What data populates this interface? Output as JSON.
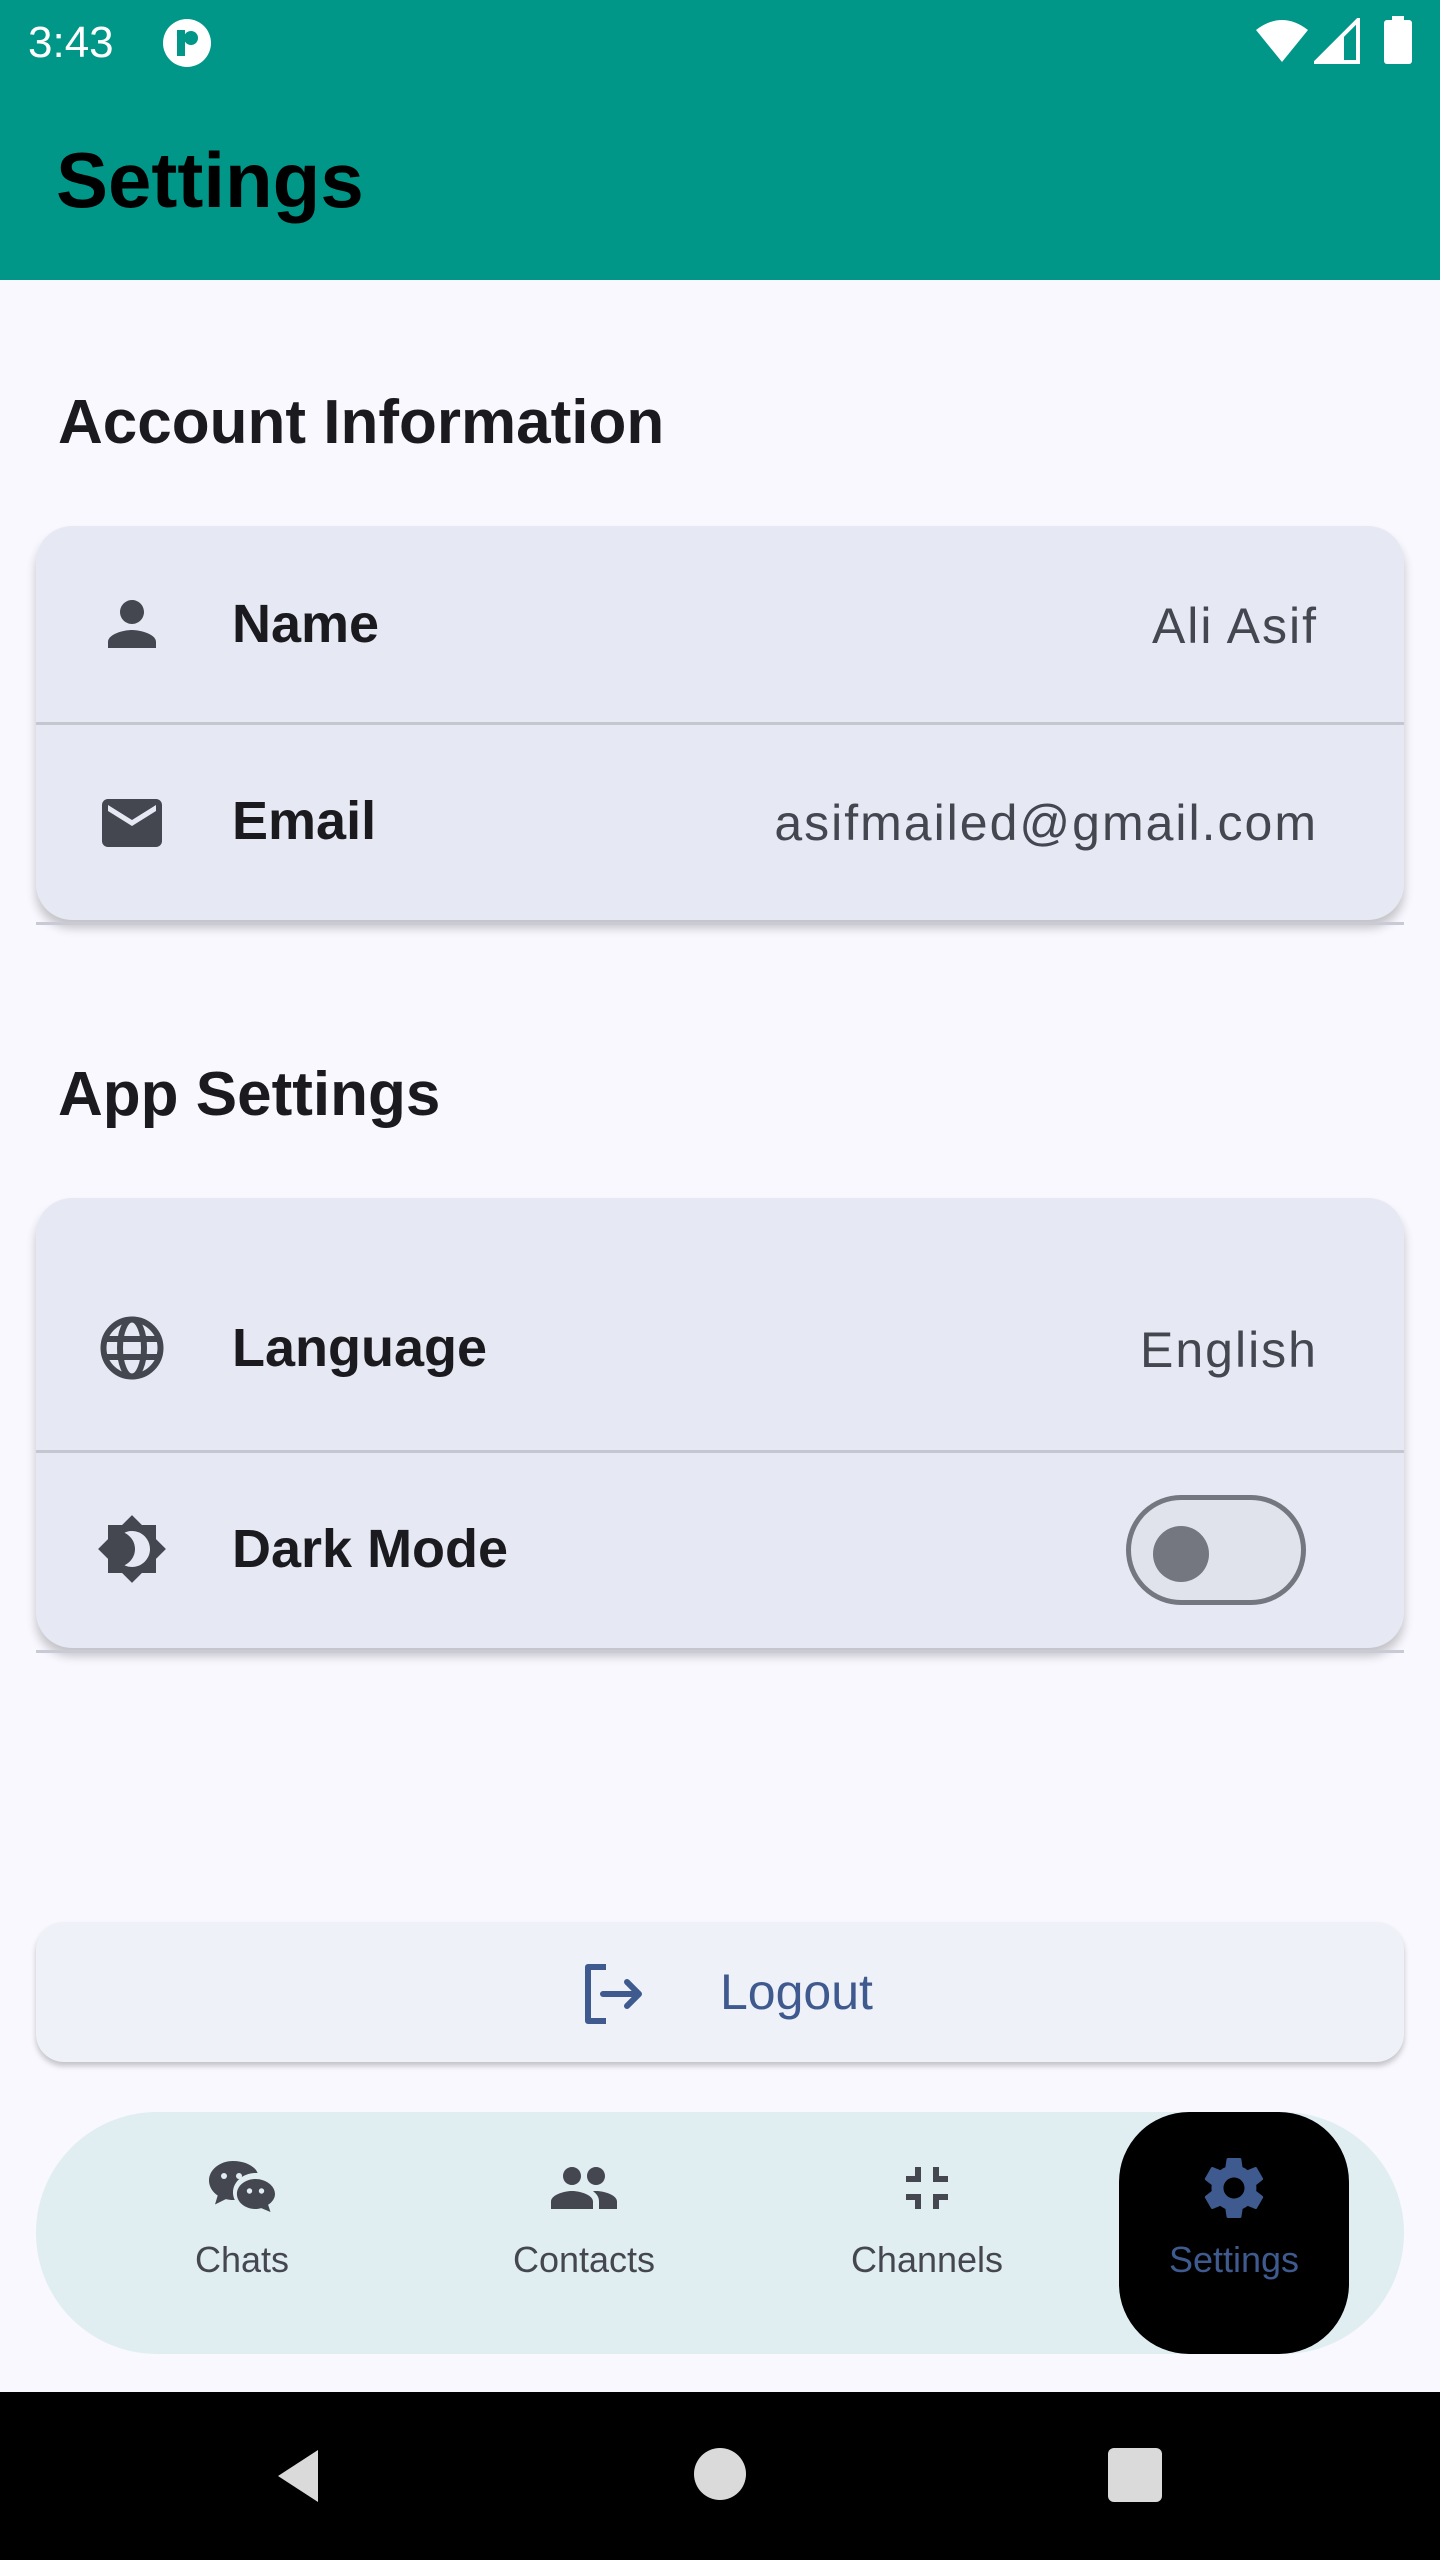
{
  "status_bar": {
    "time": "3:43"
  },
  "app_bar": {
    "title": "Settings"
  },
  "account_section": {
    "title": "Account Information",
    "rows": [
      {
        "label": "Name",
        "value": "Ali Asif",
        "icon": "person-icon"
      },
      {
        "label": "Email",
        "value": "asifmailed@gmail.com",
        "icon": "mail-icon"
      }
    ]
  },
  "app_settings_section": {
    "title": "App Settings",
    "rows": [
      {
        "label": "Language",
        "value": "English",
        "icon": "globe-icon"
      },
      {
        "label": "Dark Mode",
        "toggle_on": false,
        "icon": "brightness-icon"
      }
    ]
  },
  "logout": {
    "label": "Logout",
    "icon": "logout-icon"
  },
  "bottom_nav": {
    "items": [
      {
        "label": "Chats",
        "icon": "chat-bubbles-icon",
        "active": false
      },
      {
        "label": "Contacts",
        "icon": "people-icon",
        "active": false
      },
      {
        "label": "Channels",
        "icon": "compress-icon",
        "active": false
      },
      {
        "label": "Settings",
        "icon": "gear-icon",
        "active": true
      }
    ]
  },
  "colors": {
    "app_bar": "#009688",
    "card": "#E6E9F3",
    "accent": "#3E5A8E",
    "nav_bg": "#E0EEF2"
  }
}
